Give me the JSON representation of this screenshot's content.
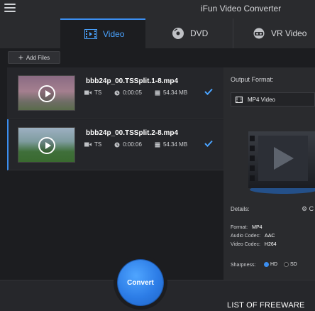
{
  "app": {
    "title": "iFun Video Converter"
  },
  "tabs": [
    {
      "label": "Video",
      "icon": "film-icon",
      "active": true
    },
    {
      "label": "DVD",
      "icon": "disc-icon",
      "active": false
    },
    {
      "label": "VR Video",
      "icon": "vr-headset-icon",
      "active": false
    }
  ],
  "toolbar": {
    "add_files_label": "Add Files"
  },
  "files": [
    {
      "name": "bbb24p_00.TSSplit.1-8.mp4",
      "format": "TS",
      "duration": "0:00:05",
      "size": "54.34 MB",
      "checked": true,
      "selected": false
    },
    {
      "name": "bbb24p_00.TSSplit.2-8.mp4",
      "format": "TS",
      "duration": "0:00:06",
      "size": "54.34 MB",
      "checked": true,
      "selected": true
    }
  ],
  "output": {
    "label": "Output Format:",
    "selected_format": "MP4 Video",
    "details_label": "Details:",
    "settings_link": "C",
    "format_label": "Format:",
    "format_value": "MP4",
    "audio_label": "Audio Codec:",
    "audio_value": "AAC",
    "video_label": "Video Codec:",
    "video_value": "H264",
    "sharpness_label": "Sharpness:",
    "sharpness_options": [
      "HD",
      "SD"
    ],
    "sharpness_selected": "HD"
  },
  "actions": {
    "convert_label": "Convert"
  },
  "watermark": "LIST OF FREEWARE",
  "colors": {
    "accent": "#3b8ef0",
    "background": "#1c1d20",
    "panel": "#2a2b2e"
  }
}
